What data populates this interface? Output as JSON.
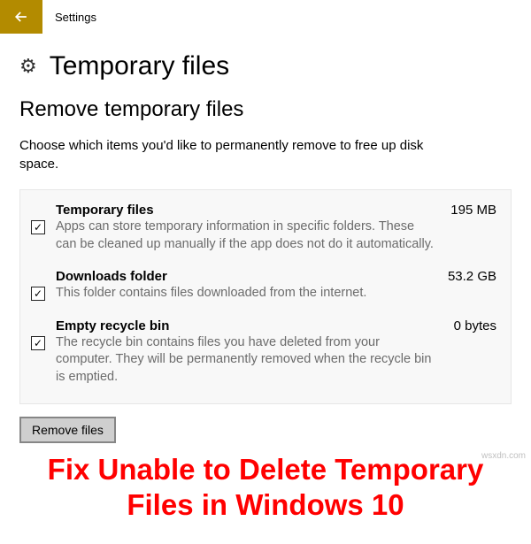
{
  "titleBar": {
    "appTitle": "Settings"
  },
  "header": {
    "pageTitle": "Temporary files"
  },
  "section": {
    "title": "Remove temporary files",
    "description": "Choose which items you'd like to permanently remove to free up disk space."
  },
  "items": [
    {
      "title": "Temporary files",
      "size": "195 MB",
      "description": "Apps can store temporary information in specific folders. These can be cleaned up manually if the app does not do it automatically.",
      "checked": true
    },
    {
      "title": "Downloads folder",
      "size": "53.2 GB",
      "description": "This folder contains files downloaded from the internet.",
      "checked": true
    },
    {
      "title": "Empty recycle bin",
      "size": "0 bytes",
      "description": "The recycle bin contains files you have deleted from your computer. They will be permanently removed when the recycle bin is emptied.",
      "checked": true
    }
  ],
  "actions": {
    "removeButtonLabel": "Remove files"
  },
  "overlay": {
    "caption": "Fix Unable to Delete Temporary Files in Windows 10"
  },
  "watermark": "wsxdn.com",
  "checkmark": "✓"
}
